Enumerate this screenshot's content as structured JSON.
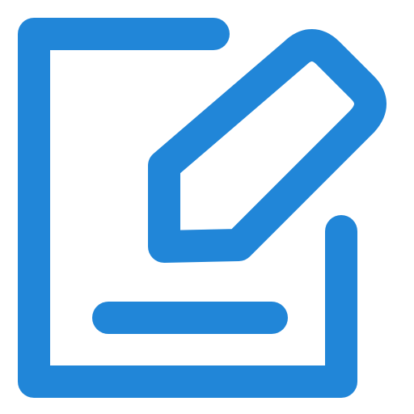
{
  "icon": {
    "name": "edit-icon",
    "parts": [
      "document-frame",
      "pencil",
      "text-line"
    ]
  },
  "colors": {
    "stroke": "#2186D8",
    "background": "#FFFFFF"
  }
}
